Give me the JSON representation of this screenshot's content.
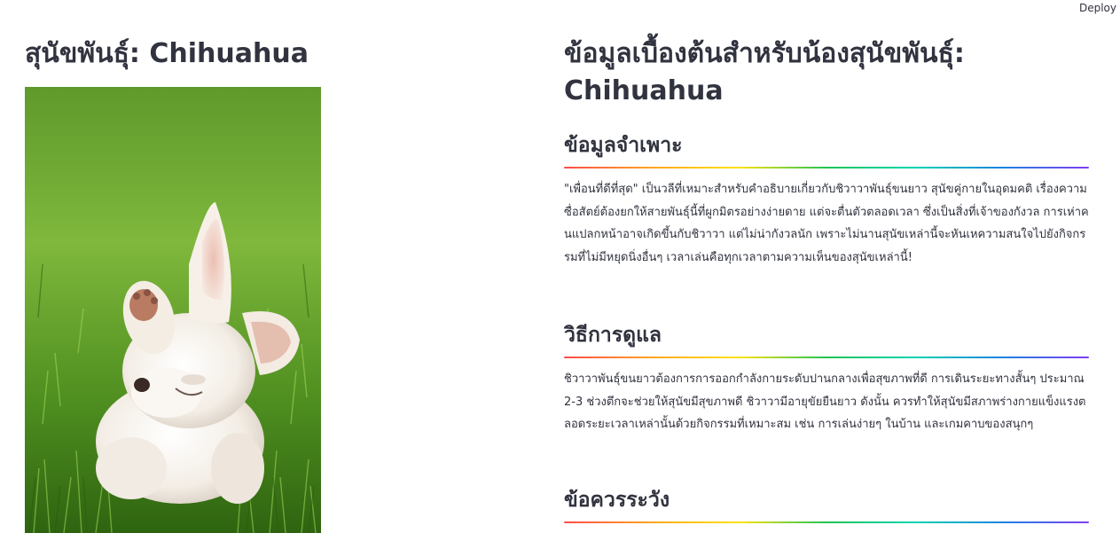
{
  "header": {
    "deploy_label": "Deploy"
  },
  "left": {
    "title": "สุนัขพันธุ์: Chihuahua",
    "image_alt": "Chihuahua puppy on grass"
  },
  "right": {
    "title": "ข้อมูลเบื้องต้นสำหรับน้องสุนัขพันธุ์: Chihuahua",
    "sections": [
      {
        "header": "ข้อมูลจำเพาะ",
        "text": "\"เพื่อนที่ดีที่สุด\" เป็นวลีที่เหมาะสำหรับคำอธิบายเกี่ยวกับชิวาวาพันธุ์ขนยาว สุนัขคู่กายในอุดมคติ เรื่องความซื่อสัตย์ต้องยกให้สายพันธุ์นี้ที่ผูกมิตรอย่างง่ายดาย แต่จะตื่นตัวตลอดเวลา ซึ่งเป็นสิ่งที่เจ้าของกังวล การเห่าคนแปลกหน้าอาจเกิดขึ้นกับชิวาวา แต่ไม่น่ากังวลนัก เพราะไม่นานสุนัขเหล่านี้จะหันเหความสนใจไปยังกิจกรรมที่ไม่มีหยุดนิ่งอื่นๆ เวลาเล่นคือทุกเวลาตามความเห็นของสุนัขเหล่านี้!"
      },
      {
        "header": "วิธีการดูแล",
        "text": "ชิวาวาพันธุ์ขนยาวต้องการการออกกำลังกายระดับปานกลางเพื่อสุขภาพที่ดี การเดินระยะทางสั้นๆ ประมาณ 2-3 ช่วงตึกจะช่วยให้สุนัขมีสุขภาพดี ชิวาวามีอายุขัยยืนยาว ดังนั้น ควรทำให้สุนัขมีสภาพร่างกายแข็งแรงตลอดระยะเวลาเหล่านั้นด้วยกิจกรรมที่เหมาะสม เช่น การเล่นง่ายๆ ในบ้าน และเกมคาบของสนุกๆ"
      },
      {
        "header": "ข้อควรระวัง",
        "text": ""
      }
    ]
  },
  "colors": {
    "text": "#31333F",
    "grass_dark": "#2f6b12",
    "grass_light": "#7bc43a",
    "dog_fur": "#f4efe8"
  }
}
